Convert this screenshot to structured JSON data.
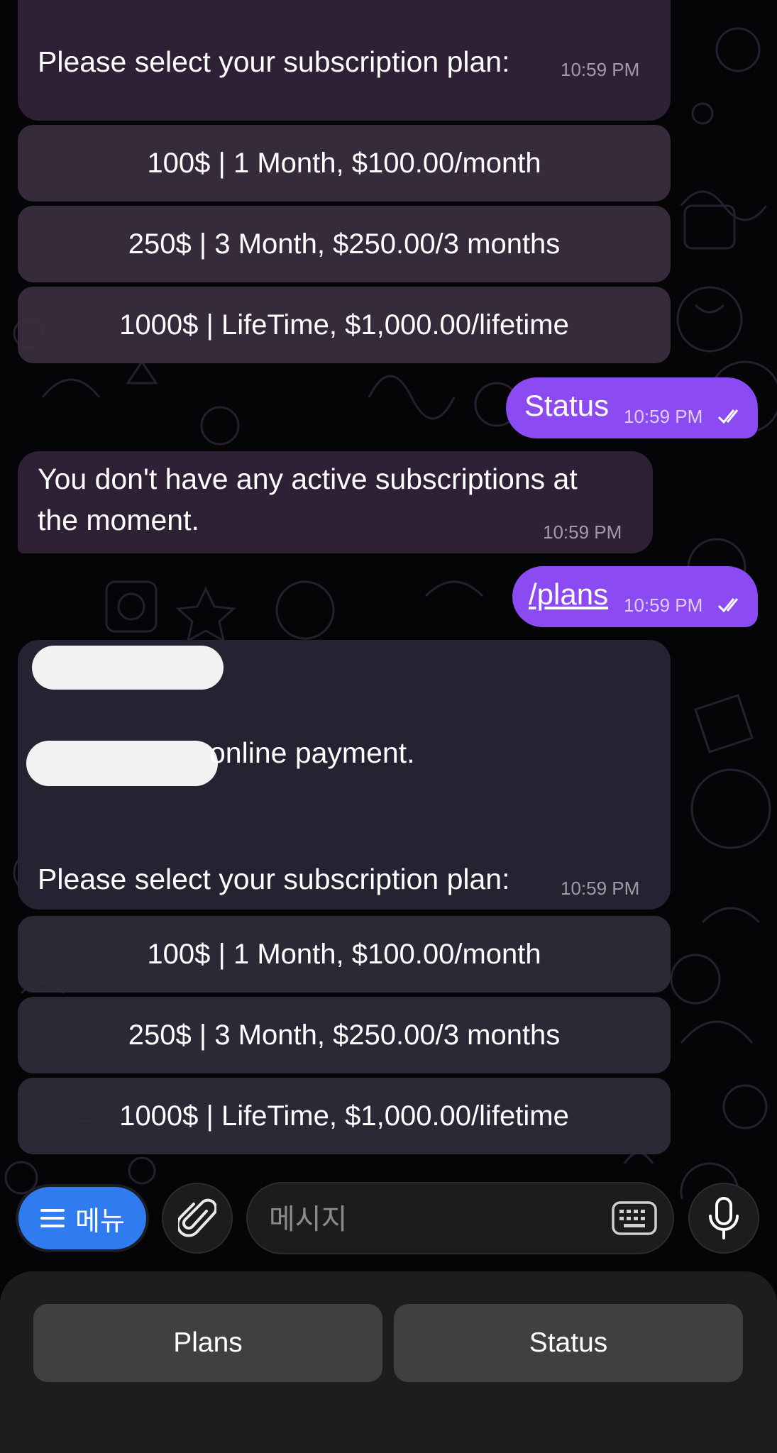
{
  "messages": [
    {
      "text": "Please select your subscription plan:",
      "time": "10:59 PM"
    },
    {
      "text": "Status",
      "time": "10:59 PM"
    },
    {
      "line1": "You don't have any active subscriptions at",
      "line2": "the moment.",
      "time": "10:59 PM"
    },
    {
      "text": "/plans",
      "time": "10:59 PM"
    },
    {
      "visible_fragment": "online payment.",
      "text": "Please select your subscription plan:",
      "time": "10:59 PM"
    }
  ],
  "plans_top": [
    {
      "label": "100$ | 1 Month, $100.00/month"
    },
    {
      "label": "250$ | 3 Month, $250.00/3 months"
    },
    {
      "label": "1000$ | LifeTime, $1,000.00/lifetime"
    }
  ],
  "plans_bottom": [
    {
      "label": "100$ | 1 Month, $100.00/month"
    },
    {
      "label": "250$ | 3 Month, $250.00/3 months"
    },
    {
      "label": "1000$ | LifeTime, $1,000.00/lifetime"
    }
  ],
  "composer": {
    "menu_label": "메뉴",
    "placeholder": "메시지",
    "icons": [
      "menu-lines-icon",
      "paperclip-icon",
      "keyboard-icon",
      "microphone-icon"
    ]
  },
  "reply_keyboard": {
    "plans_label": "Plans",
    "status_label": "Status"
  },
  "colors": {
    "outgoing_bubble": "#8c4bf2",
    "menu_button": "#2f7bf0",
    "background": "#050507"
  }
}
